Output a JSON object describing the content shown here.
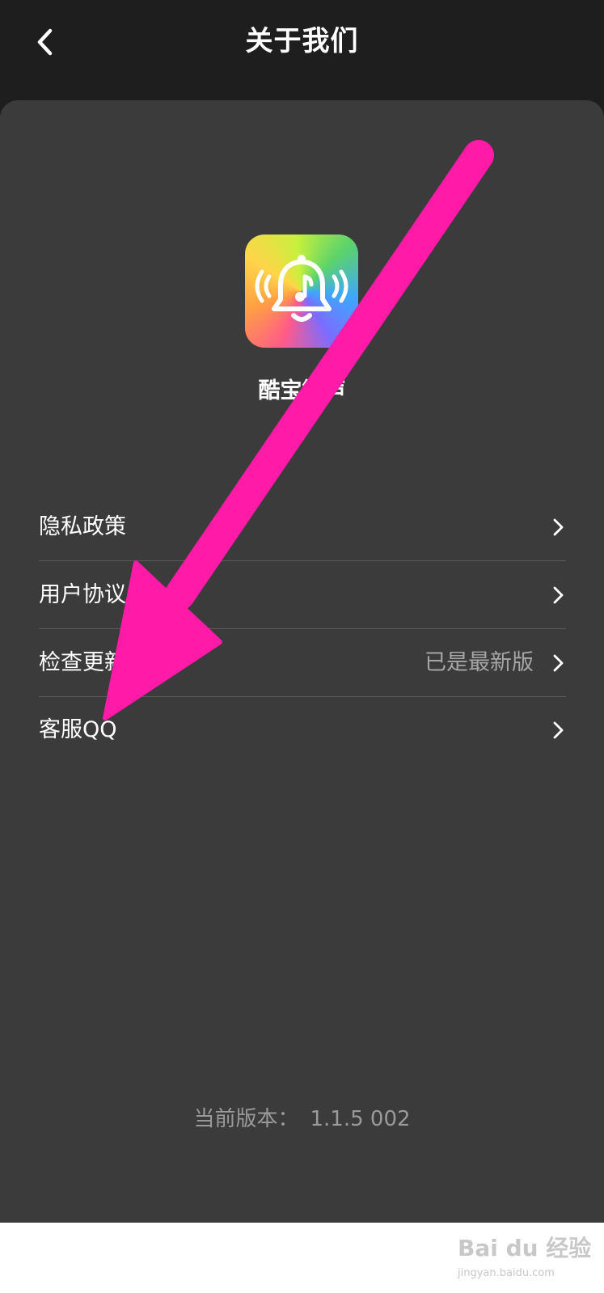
{
  "header": {
    "title": "关于我们",
    "back_icon": "chevron-left-icon"
  },
  "app": {
    "name": "酷宝铃声",
    "icon": "bell-music-icon"
  },
  "menu": [
    {
      "label": "隐私政策",
      "value": "",
      "icon": "chevron-right-icon"
    },
    {
      "label": "用户协议",
      "value": "",
      "icon": "chevron-right-icon"
    },
    {
      "label": "检查更新",
      "value": "已是最新版",
      "icon": "chevron-right-icon"
    },
    {
      "label": "客服QQ",
      "value": "",
      "icon": "chevron-right-icon"
    }
  ],
  "version": {
    "label": "当前版本：",
    "value": "1.1.5 002"
  },
  "annotation": {
    "icon": "arrow-pointer-icon",
    "color": "#ff1aa8"
  },
  "watermark": {
    "logo": "Bai du 经验",
    "url": "jingyan.baidu.com"
  },
  "colors": {
    "header_bg": "#1e1e1e",
    "card_bg": "#3b3b3b",
    "text_primary": "#ffffff",
    "text_secondary": "#a6a6a6"
  }
}
